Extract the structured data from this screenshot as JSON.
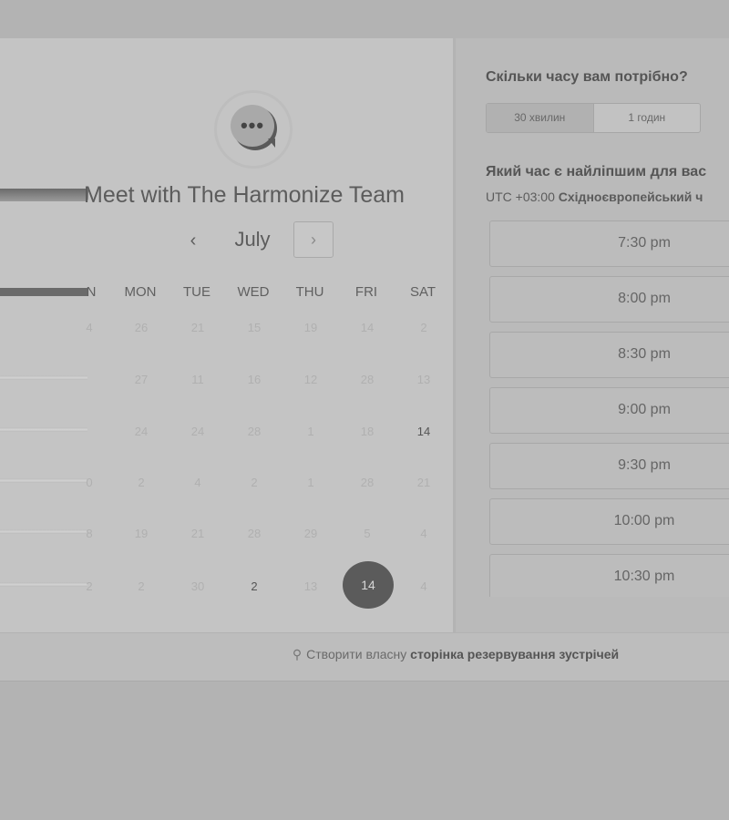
{
  "meeting": {
    "title": "Meet with The Harmonize Team"
  },
  "calendar": {
    "month": "July",
    "prev_label": "‹",
    "next_label": "›",
    "weekdays": [
      "N",
      "MON",
      "TUE",
      "WED",
      "THU",
      "FRI",
      "SAT"
    ],
    "rows": [
      [
        "4",
        "26",
        "21",
        "15",
        "19",
        "14",
        "2"
      ],
      [
        "",
        "27",
        "11",
        "16",
        "12",
        "28",
        "13"
      ],
      [
        "",
        "24",
        "24",
        "28",
        "1",
        "18",
        "14"
      ],
      [
        "0",
        "2",
        "4",
        "2",
        "1",
        "28",
        "21"
      ],
      [
        "8",
        "19",
        "21",
        "28",
        "29",
        "5",
        "4"
      ],
      [
        "2",
        "2",
        "30",
        "2",
        "13",
        "14",
        "4"
      ]
    ],
    "selected_day": "14"
  },
  "duration": {
    "question": "Скільки часу вам потрібно?",
    "options": [
      "30 хвилин",
      "1 годин"
    ],
    "selected": "30 хвилин"
  },
  "time": {
    "question": "Який час є найліпшим для вас",
    "timezone_offset": "UTC +03:00",
    "timezone_name": "Східноєвропейський ч",
    "slots": [
      "7:30 pm",
      "8:00 pm",
      "8:30 pm",
      "9:00 pm",
      "9:30 pm",
      "10:00 pm",
      "10:30 pm"
    ]
  },
  "footer": {
    "prefix": "Створити власну",
    "link": "сторінка резервування зустрічей"
  },
  "icons": {
    "logo": "chat-bubble-icon",
    "footer": "hubspot-sprocket-icon"
  }
}
